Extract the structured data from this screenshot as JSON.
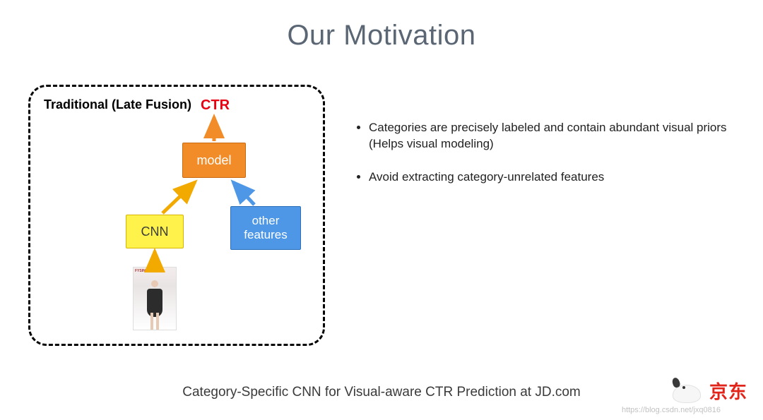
{
  "title": "Our Motivation",
  "diagram": {
    "box_label": "Traditional (Late Fusion)",
    "ctr_label": "CTR",
    "model_label": "model",
    "cnn_label": "CNN",
    "other_label": "other\nfeatures",
    "product_brand": "FYSING"
  },
  "bullets": [
    "Categories are precisely labeled and contain abundant visual priors (Helps visual modeling)",
    "Avoid extracting category-unrelated features"
  ],
  "footer": "Category-Specific CNN for Visual-aware CTR Prediction at JD.com",
  "watermark": "https://blog.csdn.net/jxq0816",
  "logo_text": "京东"
}
